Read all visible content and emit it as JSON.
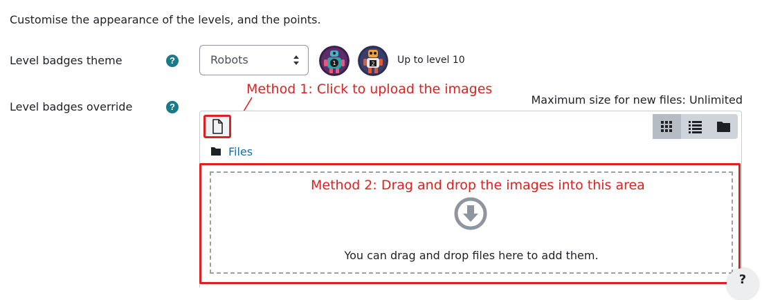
{
  "intro": "Customise the appearance of the levels, and the points.",
  "theme": {
    "label": "Level badges theme",
    "help_icon": "?",
    "select_value": "Robots",
    "preview_caption": "Up to level 10"
  },
  "override": {
    "label": "Level badges override",
    "help_icon": "?",
    "max_size": "Maximum size for new files: Unlimited",
    "breadcrumb": "Files",
    "dropzone_text": "You can drag and drop files here to add them."
  },
  "annotations": {
    "method1": "Method 1: Click to upload the images",
    "method2": "Method 2: Drag and drop the images into this area",
    "color": "#e02020"
  },
  "floating_help": "?"
}
